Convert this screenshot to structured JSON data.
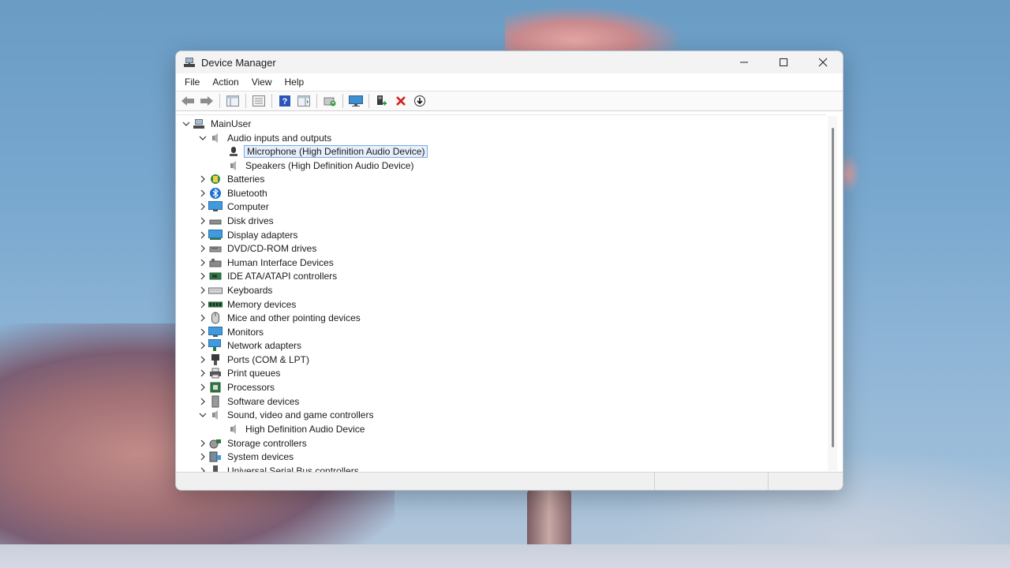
{
  "window": {
    "title": "Device Manager"
  },
  "menu": [
    "File",
    "Action",
    "View",
    "Help"
  ],
  "tree": {
    "root": "MainUser",
    "items": [
      {
        "label": "Audio inputs and outputs",
        "expanded": true,
        "icon": "speaker-icon",
        "children": [
          "Microphone (High Definition Audio Device)",
          "Speakers (High Definition Audio Device)"
        ]
      },
      {
        "label": "Batteries",
        "icon": "battery-icon"
      },
      {
        "label": "Bluetooth",
        "icon": "bluetooth-icon"
      },
      {
        "label": "Computer",
        "icon": "computer-icon"
      },
      {
        "label": "Disk drives",
        "icon": "disk-icon"
      },
      {
        "label": "Display adapters",
        "icon": "display-adapter-icon"
      },
      {
        "label": "DVD/CD-ROM drives",
        "icon": "dvd-icon"
      },
      {
        "label": "Human Interface Devices",
        "icon": "hid-icon"
      },
      {
        "label": "IDE ATA/ATAPI controllers",
        "icon": "ide-icon"
      },
      {
        "label": "Keyboards",
        "icon": "keyboard-icon"
      },
      {
        "label": "Memory devices",
        "icon": "memory-icon"
      },
      {
        "label": "Mice and other pointing devices",
        "icon": "mouse-icon"
      },
      {
        "label": "Monitors",
        "icon": "monitor-icon"
      },
      {
        "label": "Network adapters",
        "icon": "network-icon"
      },
      {
        "label": "Ports (COM & LPT)",
        "icon": "port-icon"
      },
      {
        "label": "Print queues",
        "icon": "printer-icon"
      },
      {
        "label": "Processors",
        "icon": "processor-icon"
      },
      {
        "label": "Software devices",
        "icon": "software-icon"
      },
      {
        "label": "Sound, video and game controllers",
        "expanded": true,
        "icon": "speaker-icon",
        "children": [
          "High Definition Audio Device"
        ]
      },
      {
        "label": "Storage controllers",
        "icon": "storage-icon"
      },
      {
        "label": "System devices",
        "icon": "system-icon"
      },
      {
        "label": "Universal Serial Bus controllers",
        "icon": "usb-icon"
      }
    ]
  }
}
